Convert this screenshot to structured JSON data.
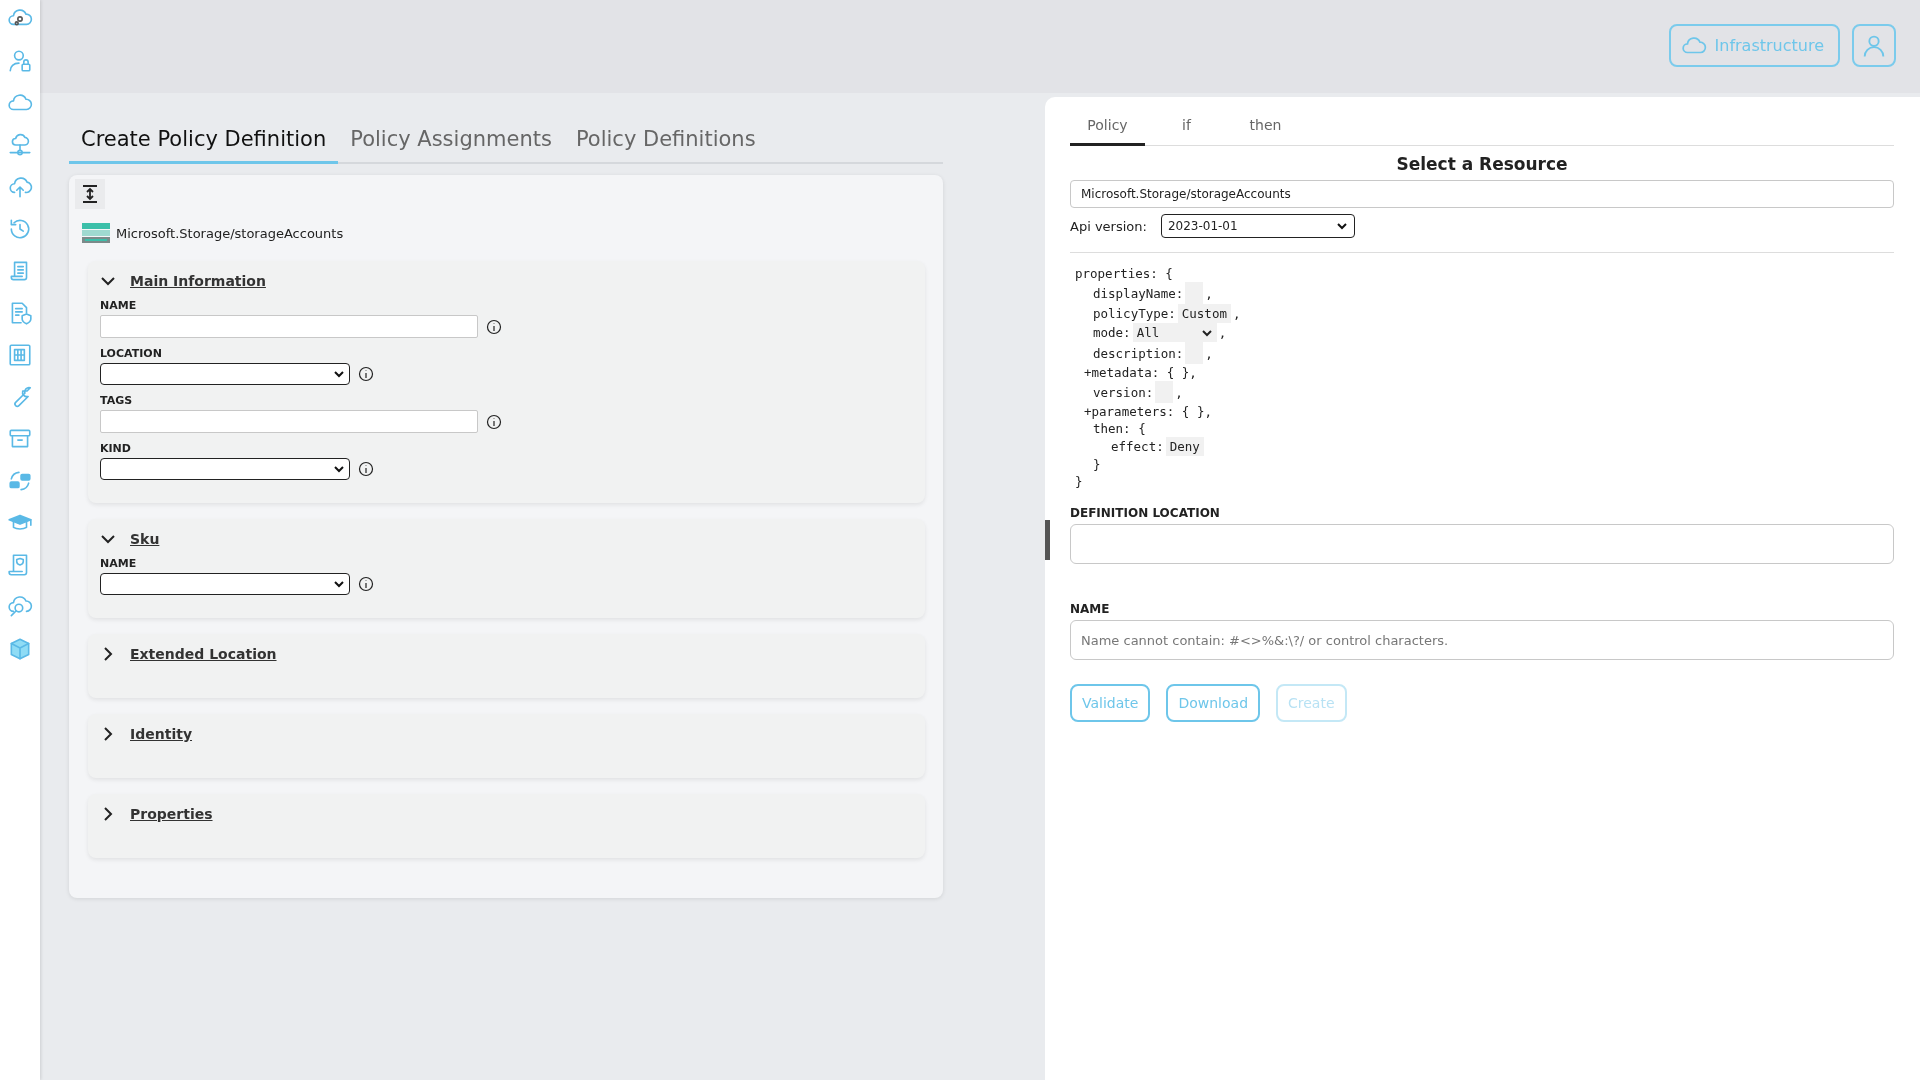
{
  "header": {
    "environment_button": "Infrastructure"
  },
  "tabs": [
    {
      "label": "Create Policy Definition",
      "selected": true
    },
    {
      "label": "Policy Assignments",
      "selected": false
    },
    {
      "label": "Policy Definitions",
      "selected": false
    }
  ],
  "resource_type": "Microsoft.Storage/storageAccounts",
  "sections": [
    {
      "title": "Main Information",
      "expanded": true,
      "fields": [
        {
          "label": "NAME",
          "kind": "text"
        },
        {
          "label": "LOCATION",
          "kind": "select"
        },
        {
          "label": "TAGS",
          "kind": "text"
        },
        {
          "label": "KIND",
          "kind": "select"
        }
      ]
    },
    {
      "title": "Sku",
      "expanded": true,
      "fields": [
        {
          "label": "NAME",
          "kind": "select"
        }
      ]
    },
    {
      "title": "Extended Location",
      "expanded": false
    },
    {
      "title": "Identity",
      "expanded": false
    },
    {
      "title": "Properties",
      "expanded": false
    }
  ],
  "editor": {
    "tabs": [
      {
        "label": "Policy",
        "selected": true
      },
      {
        "label": "if",
        "selected": false
      },
      {
        "label": "then",
        "selected": false
      }
    ],
    "heading": "Select a Resource",
    "resource_value": "Microsoft.Storage/storageAccounts",
    "api_version_label": "Api version:",
    "api_version": "2023-01-01",
    "code": [
      {
        "kind": "block",
        "text": "properties: {",
        "close": "}",
        "children": [
          {
            "kind": "field",
            "text": "displayName:",
            "suffix": ","
          },
          {
            "kind": "field",
            "text": "policyType:",
            "value": "Custom",
            "suffix": ","
          },
          {
            "kind": "select",
            "text": "mode:",
            "value": "All",
            "suffix": ","
          },
          {
            "kind": "field",
            "text": "description:",
            "suffix": ","
          },
          {
            "kind": "expandable",
            "toggle": "+",
            "text": "metadata: { },"
          },
          {
            "kind": "field",
            "text": "version:",
            "suffix": ","
          },
          {
            "kind": "expandable",
            "toggle": "+",
            "text": "parameters: { },"
          },
          {
            "kind": "block",
            "text": "then: {",
            "close": "}",
            "children": [
              {
                "kind": "field",
                "text": "effect:",
                "value": "Deny"
              }
            ]
          }
        ]
      }
    ],
    "definition_location_label": "DEFINITION LOCATION",
    "name_label": "NAME",
    "name_placeholder": "Name cannot contain: #<>%&:\\?/ or control characters.",
    "buttons": [
      {
        "label": "Validate",
        "disabled": false
      },
      {
        "label": "Download",
        "disabled": false
      },
      {
        "label": "Create",
        "disabled": true
      }
    ]
  }
}
